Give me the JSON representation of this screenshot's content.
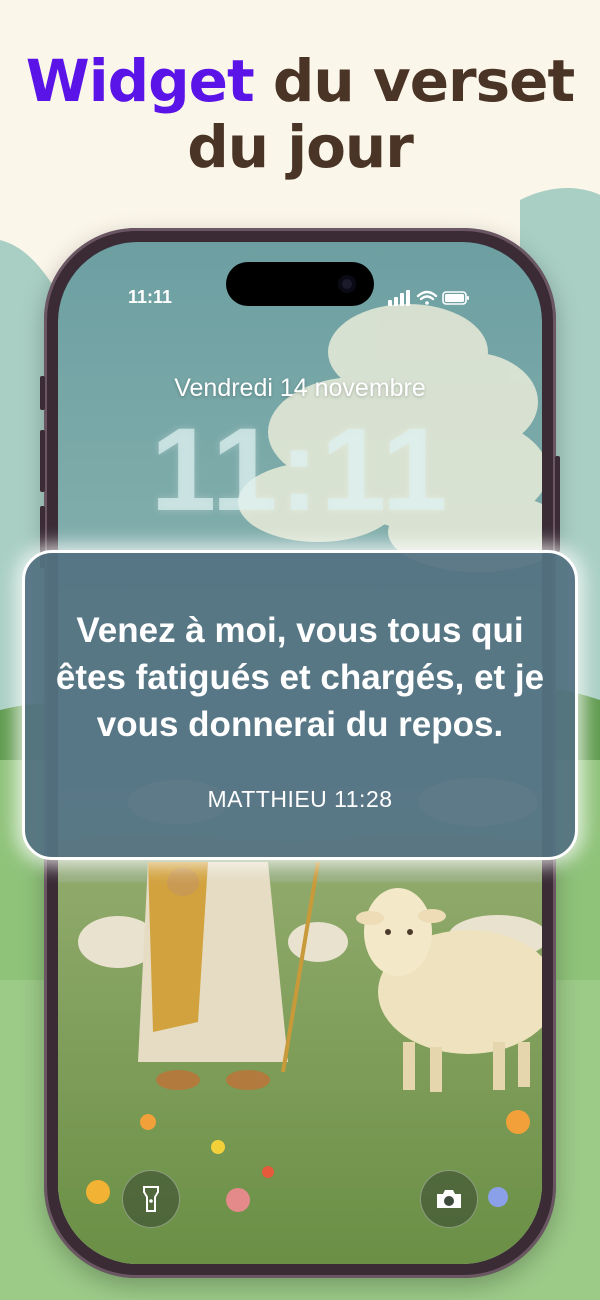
{
  "headline": {
    "accent": "Widget",
    "rest_line1": " du verset",
    "line2": "du jour"
  },
  "lockscreen": {
    "status_time": "11:11",
    "date": "Vendredi 14 novembre",
    "time": "11:11"
  },
  "widget": {
    "verse": "Venez à moi, vous tous qui êtes fatigués et chargés, et je vous donnerai du repos.",
    "reference": "MATTHIEU 11:28"
  },
  "quick_actions": {
    "left_icon": "flashlight-icon",
    "right_icon": "camera-icon"
  },
  "colors": {
    "accent": "#5b14e8",
    "headline": "#4a3426",
    "background": "#fbf6ea",
    "widget": "#547282"
  }
}
